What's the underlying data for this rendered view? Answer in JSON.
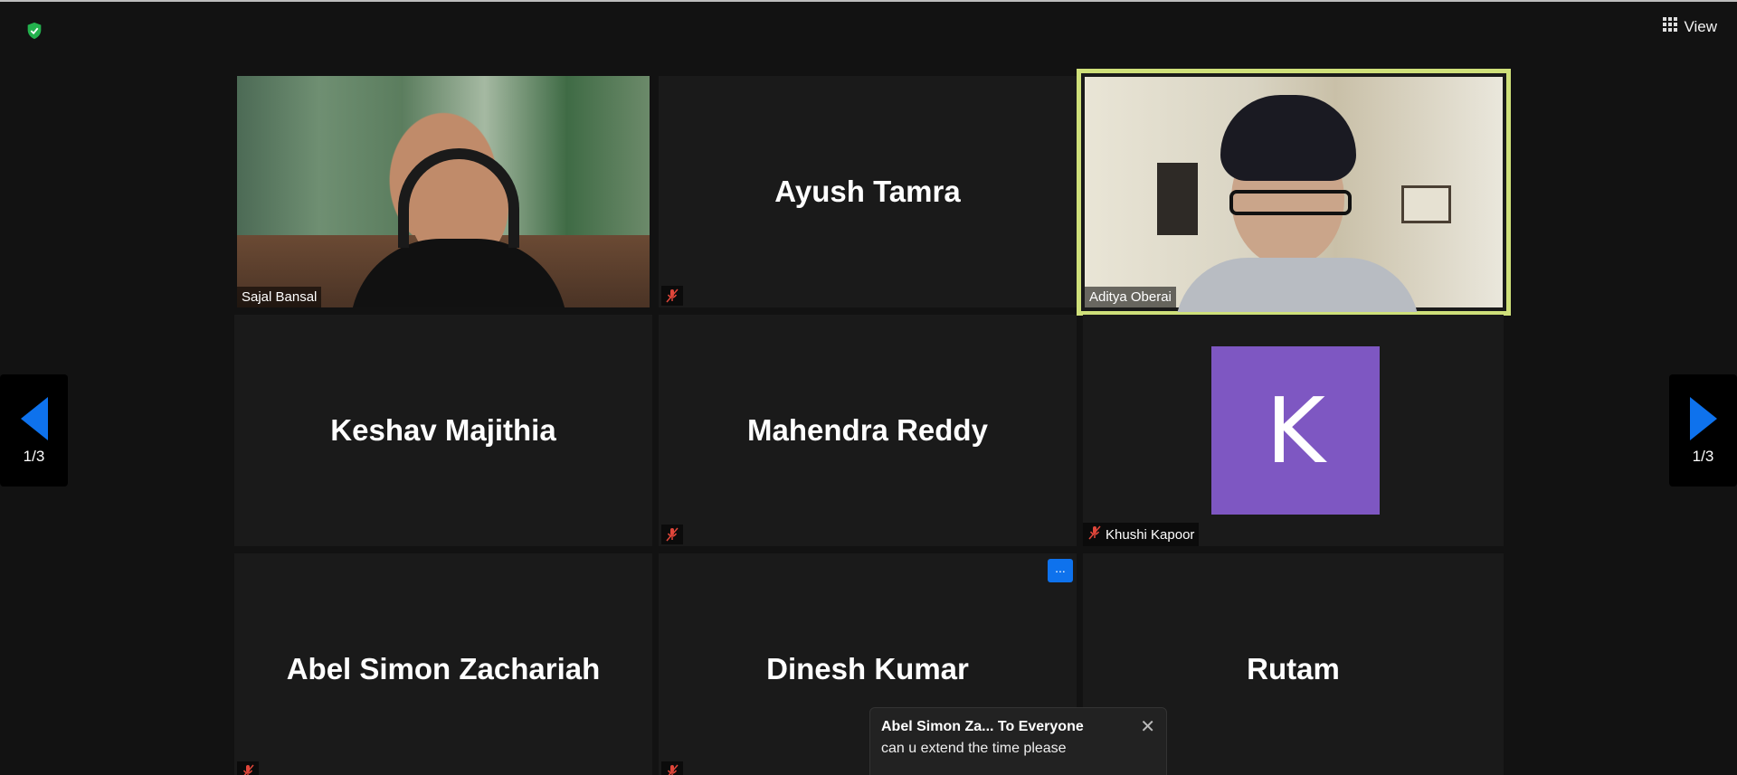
{
  "header": {
    "view_label": "View"
  },
  "participants": [
    {
      "name": "Sajal Bansal",
      "type": "video"
    },
    {
      "name": "Ayush Tamra",
      "type": "name",
      "muted": true
    },
    {
      "name": "Aditya Oberai",
      "type": "video",
      "active_speaker": true
    },
    {
      "name": "Keshav Majithia",
      "type": "name"
    },
    {
      "name": "Mahendra Reddy",
      "type": "name",
      "muted": true
    },
    {
      "name": "Khushi Kapoor",
      "type": "avatar",
      "initial": "K",
      "muted": true,
      "avatar_color": "#7e57c2"
    },
    {
      "name": "Abel Simon Zachariah",
      "type": "name",
      "muted": true
    },
    {
      "name": "Dinesh Kumar",
      "type": "name",
      "muted": true,
      "more_label": "..."
    },
    {
      "name": "Rutam",
      "type": "name",
      "muted": true
    }
  ],
  "pager": {
    "left_label": "1/3",
    "right_label": "1/3"
  },
  "chat": {
    "from": "Abel Simon Za... To Everyone",
    "message": "can u extend the time please",
    "close": "✕"
  },
  "colors": {
    "active_speaker": "#cfe07a",
    "accent_blue": "#0e72ed",
    "muted_red": "#e0463a"
  }
}
